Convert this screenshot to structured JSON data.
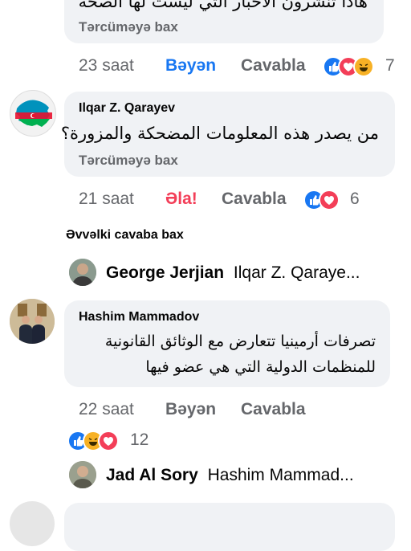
{
  "top_comment": {
    "text_partial": "هاذا تنشرون الأخبار التي ليست لها الصحة",
    "translate": "Tərcüməyə bax"
  },
  "top_actions": {
    "time": "23 saat",
    "like": "Bəyən",
    "reply": "Cavabla",
    "reactions": [
      "like-icon",
      "love-icon",
      "haha-icon"
    ],
    "count": "7"
  },
  "comment2": {
    "author": "Ilqar Z. Qarayev",
    "text": "من يصدر هذه المعلومات المضحكة والمزورة؟",
    "translate": "Tərcüməyə bax",
    "time": "21 saat",
    "like": "Əla!",
    "reply": "Cavabla",
    "reactions": [
      "like-icon",
      "love-icon"
    ],
    "count": "6"
  },
  "prev_replies": "Əvvəlki cavaba bax",
  "reply1": {
    "author": "George Jerjian",
    "text": "Ilqar Z. Qaraye..."
  },
  "comment3": {
    "author": "Hashim Mammadov",
    "line1": "تصرفات أرمينيا تتعارض مع الوثائق القانونية",
    "line2": "للمنظمات الدولية التي هي عضو فيها",
    "time": "22 saat",
    "like": "Bəyən",
    "reply": "Cavabla",
    "reactions": [
      "like-icon",
      "haha-icon",
      "love-icon"
    ],
    "count": "12"
  },
  "reply2": {
    "author": "Jad Al Sory",
    "text": "Hashim Mammad..."
  },
  "colors": {
    "bubble": "#f0f2f5",
    "meta": "#65676b",
    "like_blue": "#1877f2",
    "love_red": "#f33e58"
  }
}
